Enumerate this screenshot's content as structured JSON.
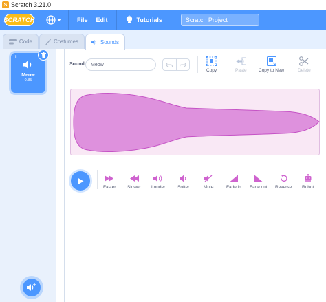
{
  "window": {
    "title": "Scratch 3.21.0"
  },
  "menu": {
    "logo_text": "SCRATCH",
    "file": "File",
    "edit": "Edit",
    "tutorials": "Tutorials",
    "project_title": "Scratch Project"
  },
  "tabs": [
    {
      "label": "Code",
      "icon": "code-icon"
    },
    {
      "label": "Costumes",
      "icon": "brush-icon"
    },
    {
      "label": "Sounds",
      "icon": "speaker-icon",
      "active": true
    }
  ],
  "sound_list": [
    {
      "index": "1",
      "name": "Meow",
      "duration": "0.85",
      "selected": true
    }
  ],
  "editor": {
    "sound_label": "Sound",
    "sound_name": "Meow",
    "copy": "Copy",
    "paste": "Paste",
    "copy_to_new": "Copy to New",
    "delete": "Delete"
  },
  "effects": [
    "Faster",
    "Slower",
    "Louder",
    "Softer",
    "Mute",
    "Fade in",
    "Fade out",
    "Reverse",
    "Robot"
  ],
  "colors": {
    "accent": "#4c97ff",
    "sound_purple": "#cf63cf",
    "waveform_fill": "#de91dd",
    "text": "#575e75"
  }
}
